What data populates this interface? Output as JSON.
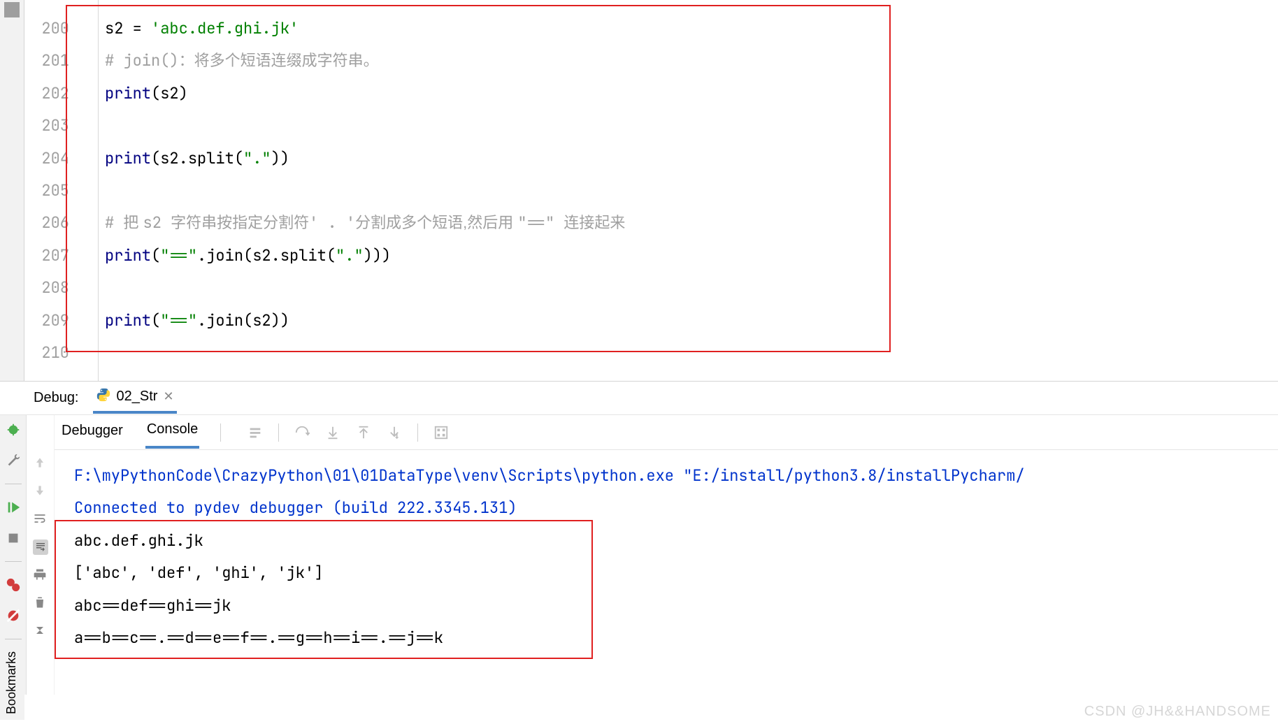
{
  "editor": {
    "line_start": 200,
    "lines": [
      {
        "n": 200,
        "tokens": [
          [
            "ident",
            "s2 "
          ],
          [
            "eq",
            "= "
          ],
          [
            "str",
            "'abc.def.ghi.jk'"
          ]
        ]
      },
      {
        "n": 201,
        "tokens": [
          [
            "cmt",
            "# join()："
          ],
          [
            "cmt-cn",
            "将多个短语连缀成字符串。"
          ]
        ]
      },
      {
        "n": 202,
        "tokens": [
          [
            "builtin",
            "print"
          ],
          [
            "ident",
            "(s2)"
          ]
        ]
      },
      {
        "n": 203,
        "tokens": []
      },
      {
        "n": 204,
        "tokens": [
          [
            "builtin",
            "print"
          ],
          [
            "ident",
            "(s2.split("
          ],
          [
            "str",
            "\".\""
          ],
          [
            "ident",
            "))"
          ]
        ]
      },
      {
        "n": 205,
        "tokens": []
      },
      {
        "n": 206,
        "tokens": [
          [
            "cmt",
            "# "
          ],
          [
            "cmt-cn",
            "把 "
          ],
          [
            "cmt",
            "s2 "
          ],
          [
            "cmt-cn",
            "字符串按指定分割符"
          ],
          [
            "cmt",
            "' . '"
          ],
          [
            "cmt-cn",
            "分割成多个短语,然后用 "
          ],
          [
            "cmt",
            "\"==\" "
          ],
          [
            "cmt-cn",
            "连接起来"
          ]
        ]
      },
      {
        "n": 207,
        "tokens": [
          [
            "builtin",
            "print"
          ],
          [
            "ident",
            "("
          ],
          [
            "str",
            "\"==\""
          ],
          [
            "ident",
            ".join(s2.split("
          ],
          [
            "str",
            "\".\""
          ],
          [
            "ident",
            ")))"
          ]
        ]
      },
      {
        "n": 208,
        "tokens": []
      },
      {
        "n": 209,
        "tokens": [
          [
            "builtin",
            "print"
          ],
          [
            "ident",
            "("
          ],
          [
            "str",
            "\"==\""
          ],
          [
            "ident",
            ".join(s2))"
          ]
        ]
      },
      {
        "n": 210,
        "tokens": []
      }
    ]
  },
  "debug": {
    "panel_label": "Debug:",
    "tab_name": "02_Str",
    "sub_tabs": {
      "debugger": "Debugger",
      "console": "Console"
    },
    "console_lines": [
      {
        "cls": "blue",
        "text": "F:\\myPythonCode\\CrazyPython\\01\\01DataType\\venv\\Scripts\\python.exe \"E:/install/python3.8/installPycharm/"
      },
      {
        "cls": "blue",
        "text": "Connected to pydev debugger (build 222.3345.131)"
      },
      {
        "cls": "",
        "text": "abc.def.ghi.jk"
      },
      {
        "cls": "",
        "text": "['abc', 'def', 'ghi', 'jk']"
      },
      {
        "cls": "",
        "text": "abc==def==ghi==jk"
      },
      {
        "cls": "",
        "text": "a==b==c==.==d==e==f==.==g==h==i==.==j==k"
      }
    ]
  },
  "bookmarks_label": "Bookmarks",
  "watermark": "CSDN @JH&&HANDSOME"
}
